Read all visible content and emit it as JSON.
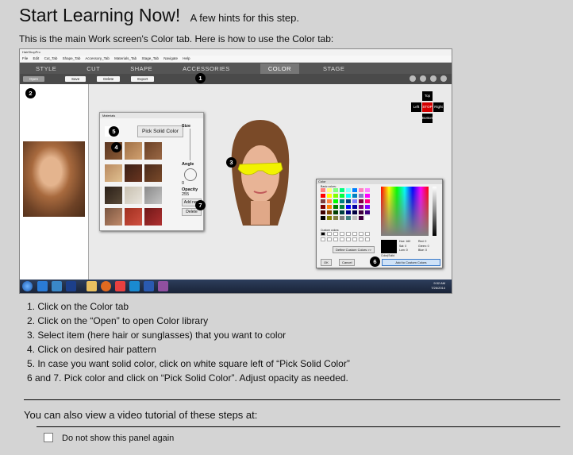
{
  "header": {
    "title": "Start Learning Now!",
    "subtitle": "A few hints for this step.",
    "intro": "This is the main Work screen's Color tab. Here is how to use the Color tab:"
  },
  "screenshot": {
    "window_title": "HairShopPro",
    "menu": [
      "File",
      "Edit",
      "Cut_Tab",
      "Shape_Tab",
      "Accessory_Tab",
      "Materials_Tab",
      "Stage_Tab",
      "Navigate",
      "Help"
    ],
    "tabs": [
      "Style",
      "Cut",
      "Shape",
      "Accessories",
      "Color",
      "Stage"
    ],
    "active_tab": "Color",
    "toolbar_buttons": [
      "Open",
      "Save",
      "Delete",
      "Export"
    ],
    "materials_title": "Materials",
    "pick_solid": "Pick Solid Color",
    "size_label": "Size",
    "angle_label": "Angle",
    "angle_value": "0",
    "opacity_label": "Opacity",
    "opacity_value": "255",
    "add_new": "Add new",
    "delete": "Delete",
    "nav": {
      "top": "Top",
      "left": "Left",
      "stop": "STOP",
      "right": "Right",
      "bottom": "Bottom"
    },
    "color_dialog": {
      "title": "Color",
      "basic_colors": "Basic colors:",
      "custom_colors": "Custom colors:",
      "define_custom": "Define Custom Colors >>",
      "ok": "OK",
      "cancel": "Cancel",
      "color_solid": "Color|Solid",
      "hue": "Hue: 160",
      "sat": "Sat: 0",
      "lum": "Lum: 0",
      "red": "Red: 0",
      "green": "Green: 0",
      "blue": "Blue: 0",
      "add_custom": "Add to Custom Colors"
    },
    "clock_time": "9:32 AM",
    "clock_date": "7/26/2014",
    "markers": [
      "1",
      "2",
      "3",
      "4",
      "5",
      "6",
      "7"
    ],
    "colors": {
      "tab_bar": "#555555",
      "sunglasses": "#f2f200",
      "stop_button": "#d40000"
    }
  },
  "steps": [
    "1. Click on the Color tab",
    "2. Click on the “Open” to open Color library",
    "3. Select item (here hair or sunglasses) that you want to color",
    "4. Click on desired hair pattern",
    "5. In case you want solid color, click on white square left of “Pick Solid Color”",
    "6 and 7. Pick color and click on “Pick Solid Color”. Adjust opacity as needed."
  ],
  "video_text": "You can also view a video tutorial of these steps at:",
  "dont_show": {
    "label": "Do not show this panel again",
    "checked": false
  }
}
